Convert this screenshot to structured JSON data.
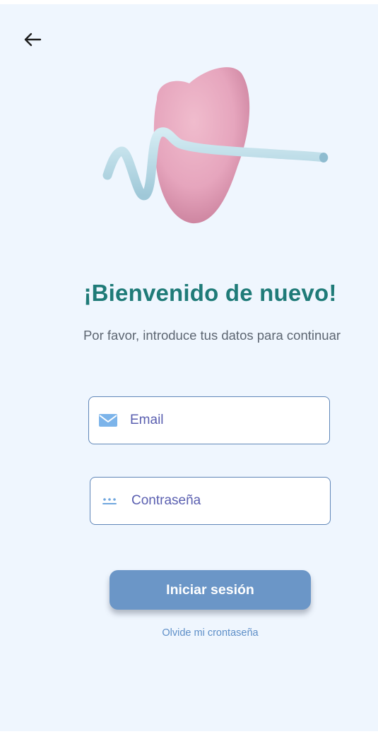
{
  "header": {
    "back_icon": "arrow-left-icon"
  },
  "hero": {
    "illustration": "tooth-heartbeat-illustration",
    "colors": {
      "tooth": "#e6a5bd",
      "line": "#b7dce8"
    }
  },
  "welcome": {
    "title": "¡Bienvenido de nuevo!",
    "subtitle": "Por favor, introduce tus datos para continuar"
  },
  "form": {
    "email": {
      "placeholder": "Email",
      "value": "",
      "icon": "mail-icon"
    },
    "password": {
      "placeholder": "Contraseña",
      "value": "",
      "icon": "password-dots-icon"
    },
    "submit_label": "Iniciar sesión",
    "forgot_label": "Olvide mi crontaseña"
  },
  "colors": {
    "background": "#eff6fe",
    "title": "#1f7b78",
    "field_border": "#5f86b8",
    "placeholder": "#5a5fb0",
    "button": "#6b96c7",
    "link": "#5e8fc8"
  }
}
